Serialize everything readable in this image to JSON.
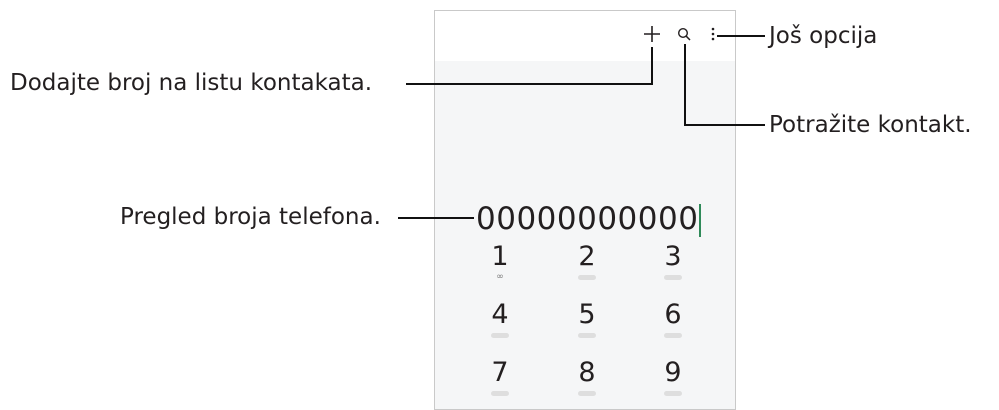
{
  "callouts": {
    "add_to_contacts": "Dodajte broj na listu kontakata.",
    "more_options": "Još opcija",
    "search_contact": "Potražite kontakt.",
    "number_preview": "Pregled broja telefona."
  },
  "toolbar": {
    "icons": [
      "plus-icon",
      "search-icon",
      "more-options-icon"
    ]
  },
  "dialer": {
    "number": "00000000000",
    "keys": [
      {
        "digit": "1",
        "sub": "voicemail"
      },
      {
        "digit": "2",
        "sub": ""
      },
      {
        "digit": "3",
        "sub": ""
      },
      {
        "digit": "4",
        "sub": ""
      },
      {
        "digit": "5",
        "sub": ""
      },
      {
        "digit": "6",
        "sub": ""
      },
      {
        "digit": "7",
        "sub": ""
      },
      {
        "digit": "8",
        "sub": ""
      },
      {
        "digit": "9",
        "sub": ""
      }
    ]
  },
  "colors": {
    "cursor": "#2f8a59",
    "leader_line": "#111111",
    "screen_background": "#f5f6f7"
  }
}
